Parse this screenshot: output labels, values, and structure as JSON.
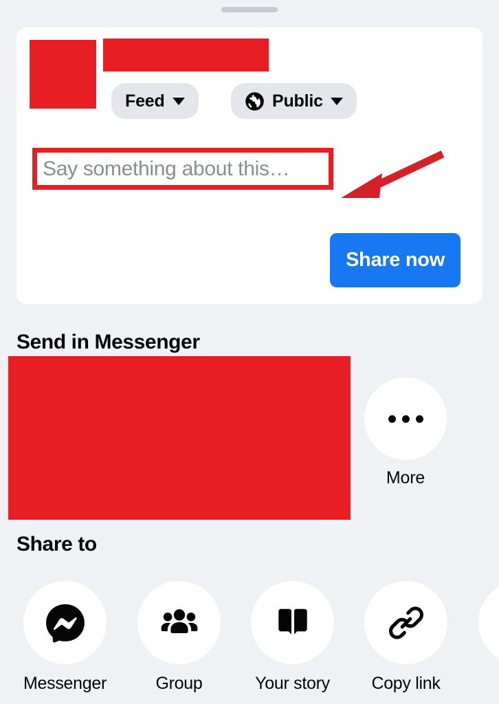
{
  "sheet": {
    "handle": "drag-handle"
  },
  "composer": {
    "avatar_redacted": true,
    "name_redacted": true,
    "destination": {
      "label": "Feed",
      "icon": "chevron-down-icon"
    },
    "audience": {
      "label": "Public",
      "icon": "globe-icon",
      "chevron": "chevron-down-icon"
    },
    "text_input": {
      "value": "",
      "placeholder": "Say something about this…",
      "highlight_color": "#e81e25"
    },
    "share_now_label": "Share now",
    "share_now_color": "#1877f2"
  },
  "annotation": {
    "arrow_color": "#e81e25",
    "points_to": "text-input"
  },
  "messenger": {
    "title": "Send in Messenger",
    "contacts_redacted": true,
    "more": {
      "label": "More",
      "icon": "ellipsis-icon"
    }
  },
  "share_to": {
    "title": "Share to",
    "items": [
      {
        "label": "Messenger",
        "icon": "messenger-icon"
      },
      {
        "label": "Group",
        "icon": "group-icon"
      },
      {
        "label": "Your story",
        "icon": "book-icon"
      },
      {
        "label": "Copy link",
        "icon": "link-icon"
      },
      {
        "label": "",
        "icon": "more-apps-icon"
      }
    ]
  },
  "theme": {
    "background": "#eff1f5",
    "card": "#ffffff",
    "redaction": "#e81e25",
    "accent": "#1877f2",
    "pill": "#e4e6eb",
    "placeholder_text": "#8a8d91"
  }
}
